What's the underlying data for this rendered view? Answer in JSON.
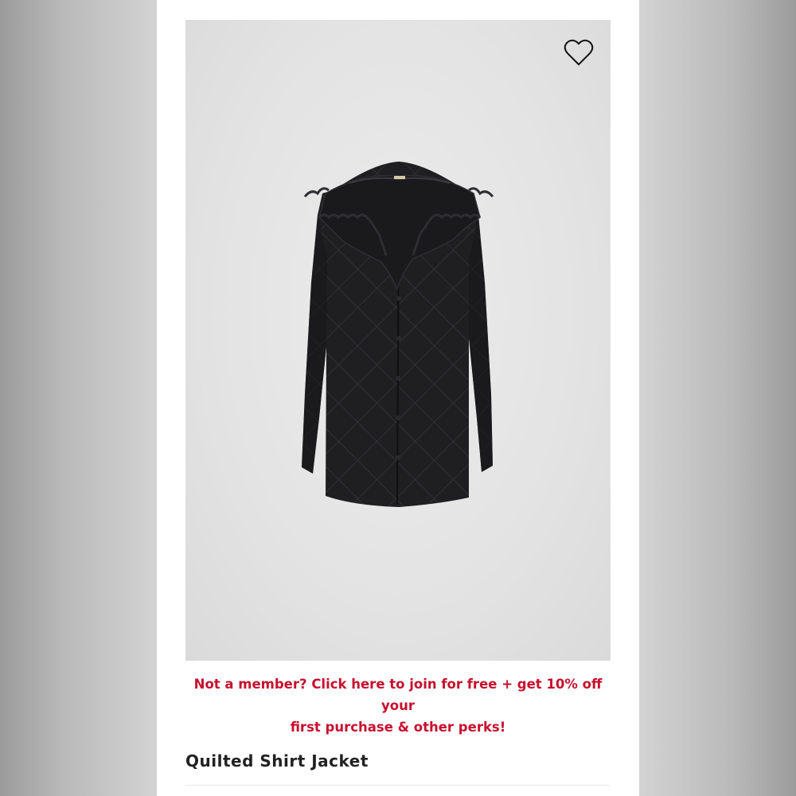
{
  "product": {
    "title": "Quilted Shirt Jacket",
    "image_icon": "black-quilted-jacket-photo"
  },
  "wishlist": {
    "icon": "heart-outline-icon"
  },
  "promo": {
    "line1": "Not a member? Click here to join for free + get 10% off your",
    "line2": "first purchase & other perks!",
    "color": "#c8102e"
  },
  "colors": {
    "image_background": "#e3e3e3",
    "garment": "#1f1f22"
  }
}
